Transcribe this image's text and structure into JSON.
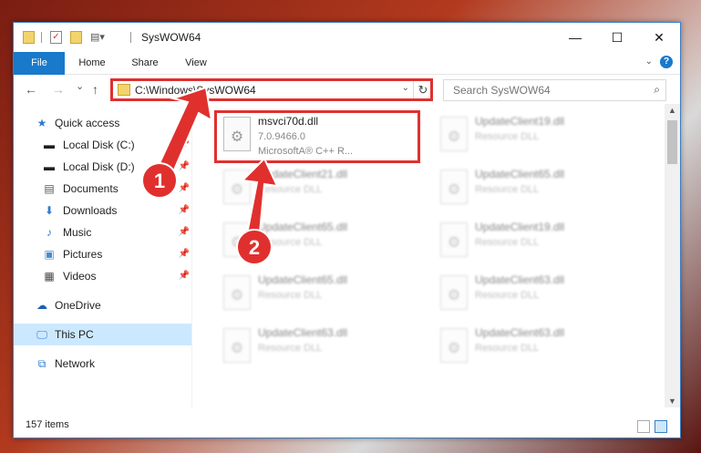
{
  "window": {
    "title": "SysWOW64"
  },
  "window_controls": {
    "minimize": "—",
    "maximize": "☐",
    "close": "✕"
  },
  "ribbon": {
    "tabs": [
      "File",
      "Home",
      "Share",
      "View"
    ],
    "help": "?"
  },
  "nav": {
    "back": "←",
    "forward": "→",
    "recent": "⌄",
    "up": "↑"
  },
  "address": {
    "path": "C:\\Windows\\SysWOW64",
    "refresh": "↻"
  },
  "search": {
    "placeholder": "Search SysWOW64"
  },
  "sidebar": {
    "items": [
      {
        "label": "Quick access",
        "icon": "star-icon",
        "pinned": false
      },
      {
        "label": "Local Disk (C:)",
        "icon": "drive-icon",
        "pinned": true
      },
      {
        "label": "Local Disk (D:)",
        "icon": "drive-icon",
        "pinned": true
      },
      {
        "label": "Documents",
        "icon": "documents-icon",
        "pinned": true
      },
      {
        "label": "Downloads",
        "icon": "download-icon",
        "pinned": true
      },
      {
        "label": "Music",
        "icon": "music-icon",
        "pinned": true
      },
      {
        "label": "Pictures",
        "icon": "pictures-icon",
        "pinned": true
      },
      {
        "label": "Videos",
        "icon": "videos-icon",
        "pinned": true
      },
      {
        "label": "OneDrive",
        "icon": "cloud-icon",
        "pinned": false
      },
      {
        "label": "This PC",
        "icon": "computer-icon",
        "pinned": false,
        "selected": true
      },
      {
        "label": "Network",
        "icon": "network-icon",
        "pinned": false
      }
    ]
  },
  "files": [
    {
      "name": "msvci70d.dll",
      "line2": "7.0.9466.0",
      "line3": "MicrosoftA® C++ R...",
      "highlighted": true
    },
    {
      "name": "UpdateClient19.dll",
      "line2": "Resource DLL",
      "blurred": true
    },
    {
      "name": "UpdateClient21.dll",
      "line2": "Resource DLL",
      "blurred": true
    },
    {
      "name": "UpdateClient65.dll",
      "line2": "Resource DLL",
      "blurred": true
    },
    {
      "name": "UpdateClient65.dll",
      "line2": "Resource DLL",
      "blurred": true
    },
    {
      "name": "UpdateClient19.dll",
      "line2": "Resource DLL",
      "blurred": true
    },
    {
      "name": "UpdateClient65.dll",
      "line2": "Resource DLL",
      "blurred": true
    },
    {
      "name": "UpdateClient63.dll",
      "line2": "Resource DLL",
      "blurred": true
    },
    {
      "name": "UpdateClient63.dll",
      "line2": "Resource DLL",
      "blurred": true
    },
    {
      "name": "UpdateClient63.dll",
      "line2": "Resource DLL",
      "blurred": true
    }
  ],
  "status": {
    "item_count": "157 items"
  },
  "annotations": {
    "badge1": "1",
    "badge2": "2",
    "color": "#e0302e"
  },
  "colors": {
    "accent": "#1979ca",
    "selected": "#cce8ff",
    "highlight": "#e0302e"
  }
}
